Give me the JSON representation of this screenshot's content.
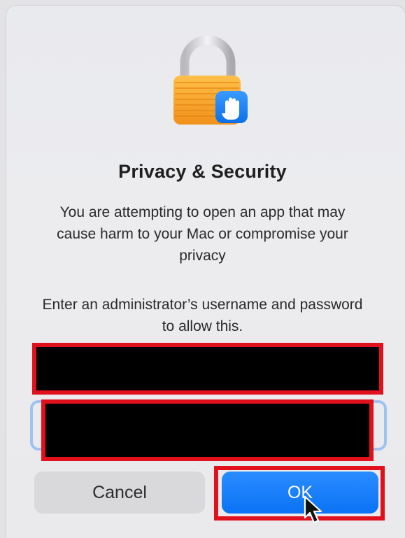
{
  "dialog": {
    "icon": "lock-with-hand-icon",
    "title": "Privacy & Security",
    "message": "You are attempting to open an app that may cause harm to your Mac or compromise your privacy",
    "instructions": "Enter an administrator’s username and password to allow this."
  },
  "fields": {
    "username_value": "",
    "password_value": ""
  },
  "buttons": {
    "cancel_label": "Cancel",
    "ok_label": "OK"
  },
  "colors": {
    "accent": "#0a73f5",
    "redaction": "#000000",
    "highlight": "#e0111c",
    "focus_ring": "#9fc3ef"
  }
}
